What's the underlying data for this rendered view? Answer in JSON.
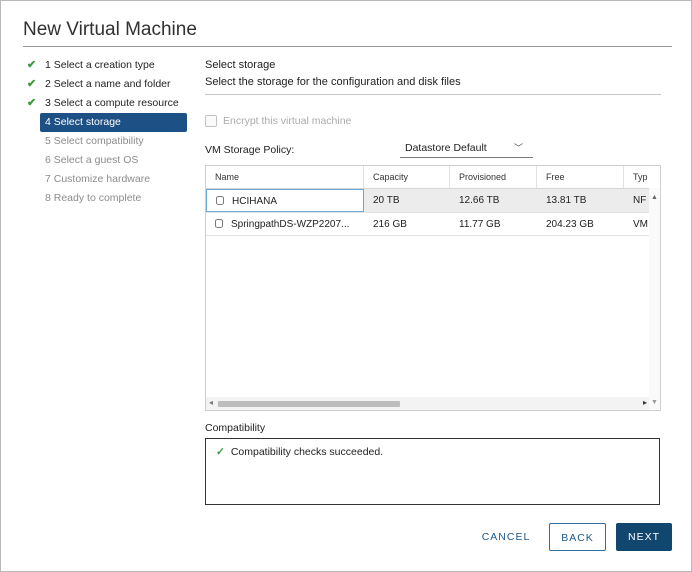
{
  "dialog": {
    "title": "New Virtual Machine"
  },
  "steps": [
    {
      "label": "1 Select a creation type",
      "state": "done"
    },
    {
      "label": "2 Select a name and folder",
      "state": "done"
    },
    {
      "label": "3 Select a compute resource",
      "state": "done"
    },
    {
      "label": "4 Select storage",
      "state": "active"
    },
    {
      "label": "5 Select compatibility",
      "state": "todo"
    },
    {
      "label": "6 Select a guest OS",
      "state": "todo"
    },
    {
      "label": "7 Customize hardware",
      "state": "todo"
    },
    {
      "label": "8 Ready to complete",
      "state": "todo"
    }
  ],
  "content": {
    "heading": "Select storage",
    "description": "Select the storage for the configuration and disk files"
  },
  "encrypt": {
    "label": "Encrypt this virtual machine",
    "checked": false,
    "disabled": true
  },
  "policy": {
    "label": "VM Storage Policy:",
    "value": "Datastore Default"
  },
  "grid": {
    "columns": [
      "Name",
      "Capacity",
      "Provisioned",
      "Free",
      "Typ"
    ],
    "rows": [
      {
        "name": "HCIHANA",
        "capacity": "20 TB",
        "provisioned": "12.66 TB",
        "free": "13.81 TB",
        "type": "NF",
        "selected": true
      },
      {
        "name": "SpringpathDS-WZP2207...",
        "capacity": "216 GB",
        "provisioned": "11.77 GB",
        "free": "204.23 GB",
        "type": "VM",
        "selected": false
      }
    ]
  },
  "compatibility": {
    "label": "Compatibility",
    "message": "Compatibility checks succeeded."
  },
  "buttons": {
    "cancel": "CANCEL",
    "back": "BACK",
    "next": "NEXT"
  },
  "colors": {
    "accent": "#1d5185",
    "primary_button": "#11466f",
    "success": "#3a9a3a"
  }
}
